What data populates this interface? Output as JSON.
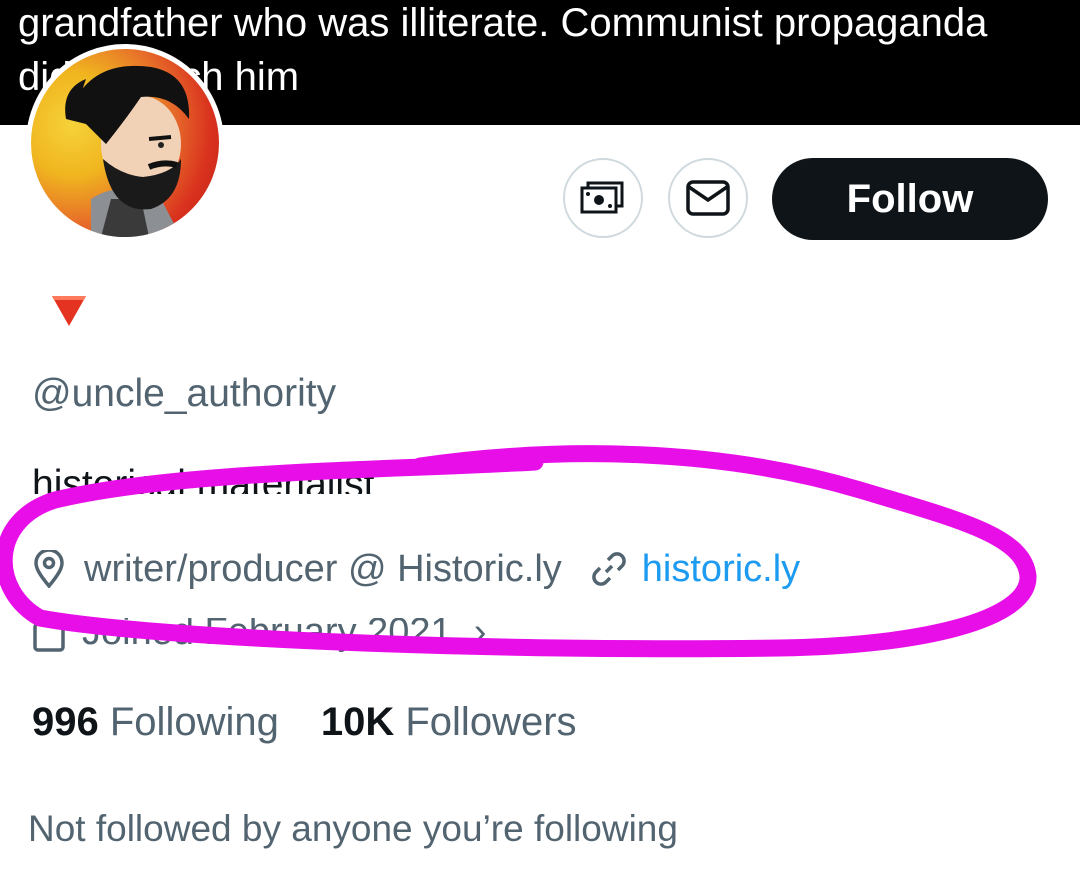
{
  "banner": {
    "text": "grandfather who was illiterate. Communist propaganda\ndidn't reach him"
  },
  "profile": {
    "avatar_alt": "bearded man cartoon avatar",
    "flair_icon": "red-triangle-down-icon",
    "handle": "@uncle_authority",
    "bio": "historical materialist",
    "location": "writer/producer @ Historic.ly",
    "website": "historic.ly",
    "joined": "Joined February 2021"
  },
  "actions": {
    "tip_icon": "money-icon",
    "message_icon": "envelope-icon",
    "follow_label": "Follow"
  },
  "stats": {
    "following_count": "996",
    "following_label": "Following",
    "followers_count": "10K",
    "followers_label": "Followers"
  },
  "footer": {
    "not_followed": "Not followed by anyone you’re following"
  },
  "colors": {
    "banner_bg": "#000000",
    "follow_bg": "#0f1419",
    "secondary_text": "#536471",
    "link": "#1d9bf0",
    "highlight": "#e80ee8"
  }
}
